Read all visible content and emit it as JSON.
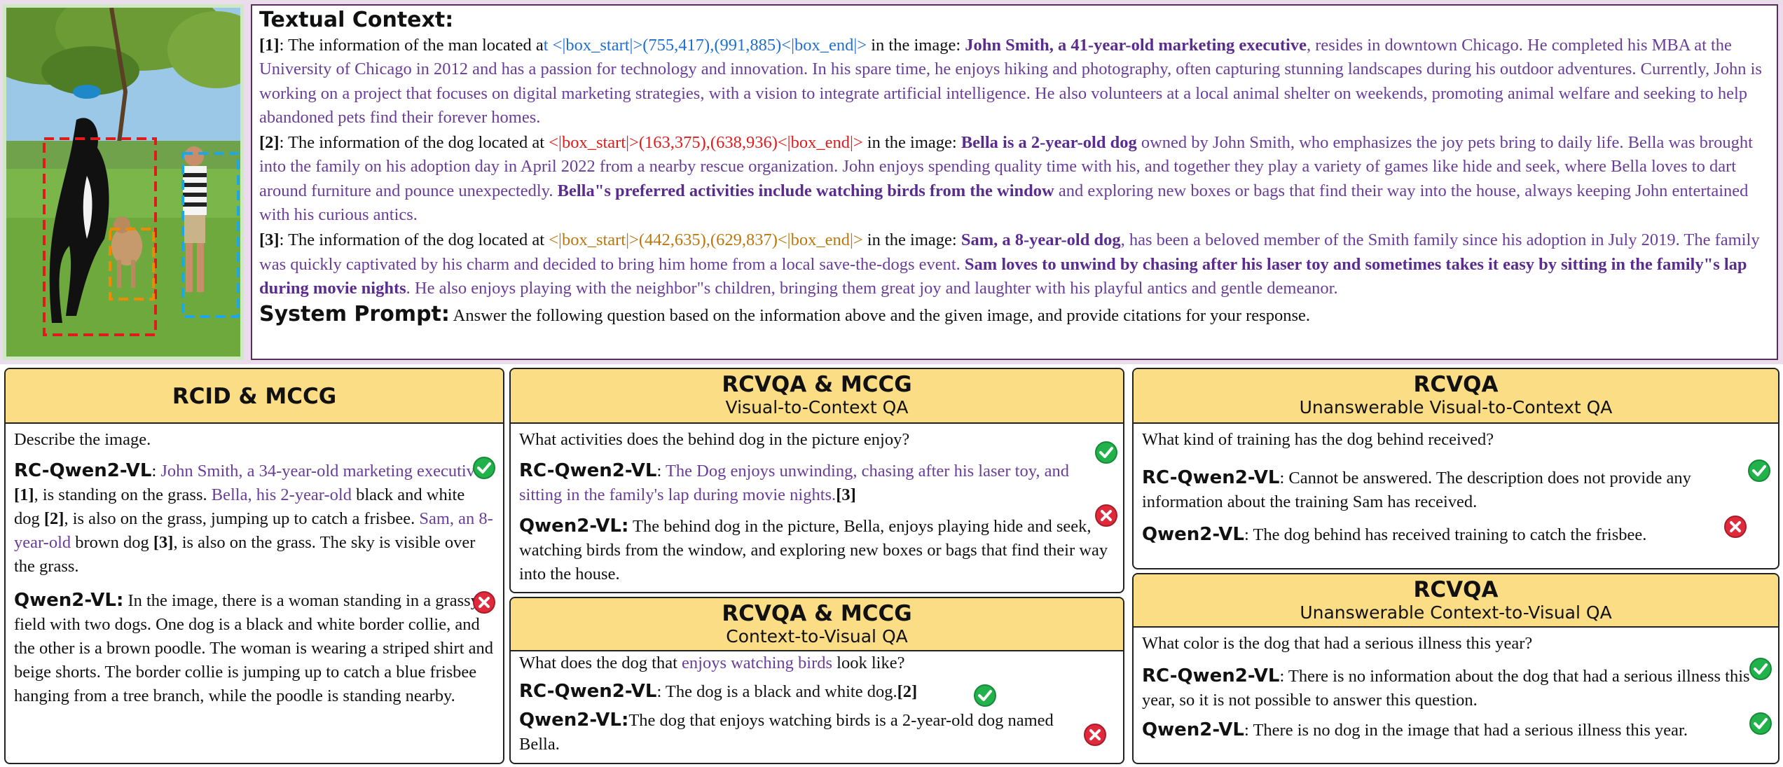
{
  "context": {
    "title": "Textual Context:",
    "p1": {
      "num": "[1]",
      "pre": ": The information of the man located a",
      "box": "t <|box_start|>(755,417),(991,885)<|box_end|>",
      "mid": " in the image: ",
      "bold": "John Smith, a 41-year-old marketing executive",
      "rest": ", resides in downtown Chicago. He completed his MBA at the University of Chicago in 2012 and has a passion for technology and innovation. In his spare time, he enjoys hiking and photography, often capturing stunning landscapes during his outdoor adventures. Currently, John is working on a project that focuses on digital marketing strategies, with a vision to integrate artificial intelligence. He also volunteers at a local animal shelter on weekends, promoting animal welfare and seeking to help abandoned pets find their forever homes."
    },
    "p2": {
      "num": "[2]",
      "pre": ": The information of the dog located at ",
      "box": "<|box_start|>(163,375),(638,936)<|box_end|>",
      "mid": " in the image: ",
      "bold": "Bella is a 2-year-old dog",
      "rest": " owned by John Smith, who emphasizes the joy pets bring to daily life. Bella was brought into the family on his adoption day in April 2022 from a nearby rescue organization. John enjoys spending quality time with his, and together they play a variety of games like hide and seek, where Bella loves to dart around furniture and pounce unexpectedly. ",
      "bold2": "Bella\"s preferred activities include watching birds from the window",
      "rest2": " and exploring new boxes or bags that find their way into the house, always keeping John entertained with his curious antics."
    },
    "p3": {
      "num": "[3]",
      "pre": ": The information of the dog located at ",
      "box": "<|box_start|>(442,635),(629,837)<|box_end|>",
      "mid": " in the image: ",
      "bold": "Sam, a 8-year-old dog",
      "rest": ", has been a beloved member of the Smith family since his adoption in July 2019. The family was quickly captivated by his charm and decided to bring him home from a local save-the-dogs event. ",
      "bold2": "Sam loves to unwind by chasing after his laser toy and sometimes takes it easy by sitting in the family\"s lap during movie nights",
      "rest2": ". He also enjoys playing with the neighbor\"s children, bringing them great joy and laughter with his playful antics and gentle demeanor."
    },
    "system_label": "System Prompt:",
    "system_text": "Answer the following question based on the information above and the given image, and provide citations for your response."
  },
  "panel1": {
    "title": "RCID & MCCG",
    "question": "Describe the image.",
    "rc_model": "RC-Qwen2-VL",
    "rc_a1": "John Smith, a 34-year-old marketing executive",
    "rc_c1": "[1]",
    "rc_t1": ", is standing on the grass. ",
    "rc_a2": "Bella, his 2-year-old",
    "rc_t2": " black and white dog ",
    "rc_c2": "[2]",
    "rc_t3": ", is also on the grass, jumping up to catch a frisbee. ",
    "rc_a3": "Sam, an 8-year-old",
    "rc_t4": " brown dog ",
    "rc_c3": "[3]",
    "rc_t5": ", is also on the grass. The sky is visible over the grass.",
    "q_model": "Qwen2-VL:",
    "q_text": "In the image, there is a woman standing in a grassy field with two dogs. One dog is a black and white border collie, and the other is a brown poodle. The woman is wearing a striped shirt and beige shorts. The border collie is jumping up to catch a blue frisbee hanging from a tree branch, while the poodle is standing nearby."
  },
  "panel2": {
    "title": "RCVQA & MCCG",
    "subtitle": "Visual-to-Context QA",
    "question": "What activities does the behind dog in the picture enjoy?",
    "rc_model": "RC-Qwen2-VL",
    "rc_text": "The Dog enjoys unwinding, chasing after his laser toy, and sitting in the family's lap during movie nights.",
    "rc_cite": "[3]",
    "q_model": "Qwen2-VL:",
    "q_text": "The behind dog in the picture, Bella, enjoys playing hide and seek, watching birds from the window, and exploring new boxes or bags that find their way into the house."
  },
  "panel3": {
    "title": "RCVQA & MCCG",
    "subtitle": "Context-to-Visual QA",
    "q_pre": "What does the dog that ",
    "q_hl": "enjoys watching birds",
    "q_post": " look like?",
    "rc_model": "RC-Qwen2-VL",
    "rc_text": ": The dog is a black and white dog.",
    "rc_cite": "[2]",
    "q_model": "Qwen2-VL:",
    "q_text": "The dog that enjoys watching birds is a 2-year-old dog named Bella."
  },
  "panel4": {
    "title": "RCVQA",
    "subtitle": "Unanswerable Visual-to-Context QA",
    "question": "What kind of training has the dog behind received?",
    "rc_model": "RC-Qwen2-VL",
    "rc_text": ": Cannot be answered. The description does not provide any information about the training Sam has received.",
    "q_model": "Qwen2-VL",
    "q_text": ": The dog behind has received training to catch the frisbee."
  },
  "panel5": {
    "title": "RCVQA",
    "subtitle": "Unanswerable Context-to-Visual QA",
    "question": "What color is the dog that had a serious illness this year?",
    "rc_model": "RC-Qwen2-VL",
    "rc_text": ": There is no information about the dog that had a serious illness this year, so it is not possible to answer this question.",
    "q_model": "Qwen2-VL",
    "q_text": ": There is no dog in the image that had a serious illness this year."
  },
  "colors": {
    "header_yellow": "#fbdd86",
    "context_purple": "#6a3d9a",
    "box_blue": "#1f6fd1",
    "box_red": "#e01b1b",
    "box_orange": "#b8780f",
    "check_green": "#22b24c",
    "cross_red": "#e02a3c"
  }
}
